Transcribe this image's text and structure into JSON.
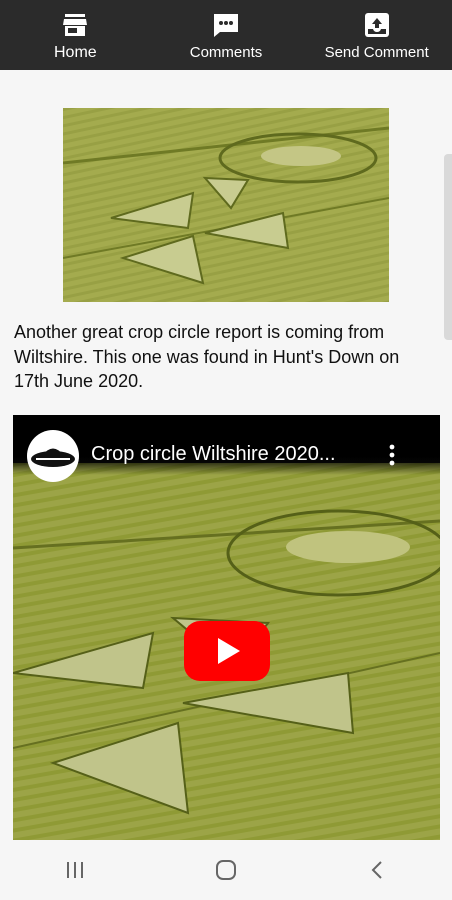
{
  "tabs": [
    {
      "label": "Home",
      "icon": "store-icon"
    },
    {
      "label": "Comments",
      "icon": "chat-icon"
    },
    {
      "label": "Send Comment",
      "icon": "inbox-upload-icon"
    }
  ],
  "article": {
    "text": "Another great crop circle report is coming from Wiltshire. This one was found in Hunt's Down on 17th June 2020."
  },
  "video": {
    "title": "Crop circle Wiltshire 2020..."
  },
  "colors": {
    "topbar": "#2b2b2b",
    "field": "#8f9a35",
    "youtube_red": "#ff0000"
  }
}
